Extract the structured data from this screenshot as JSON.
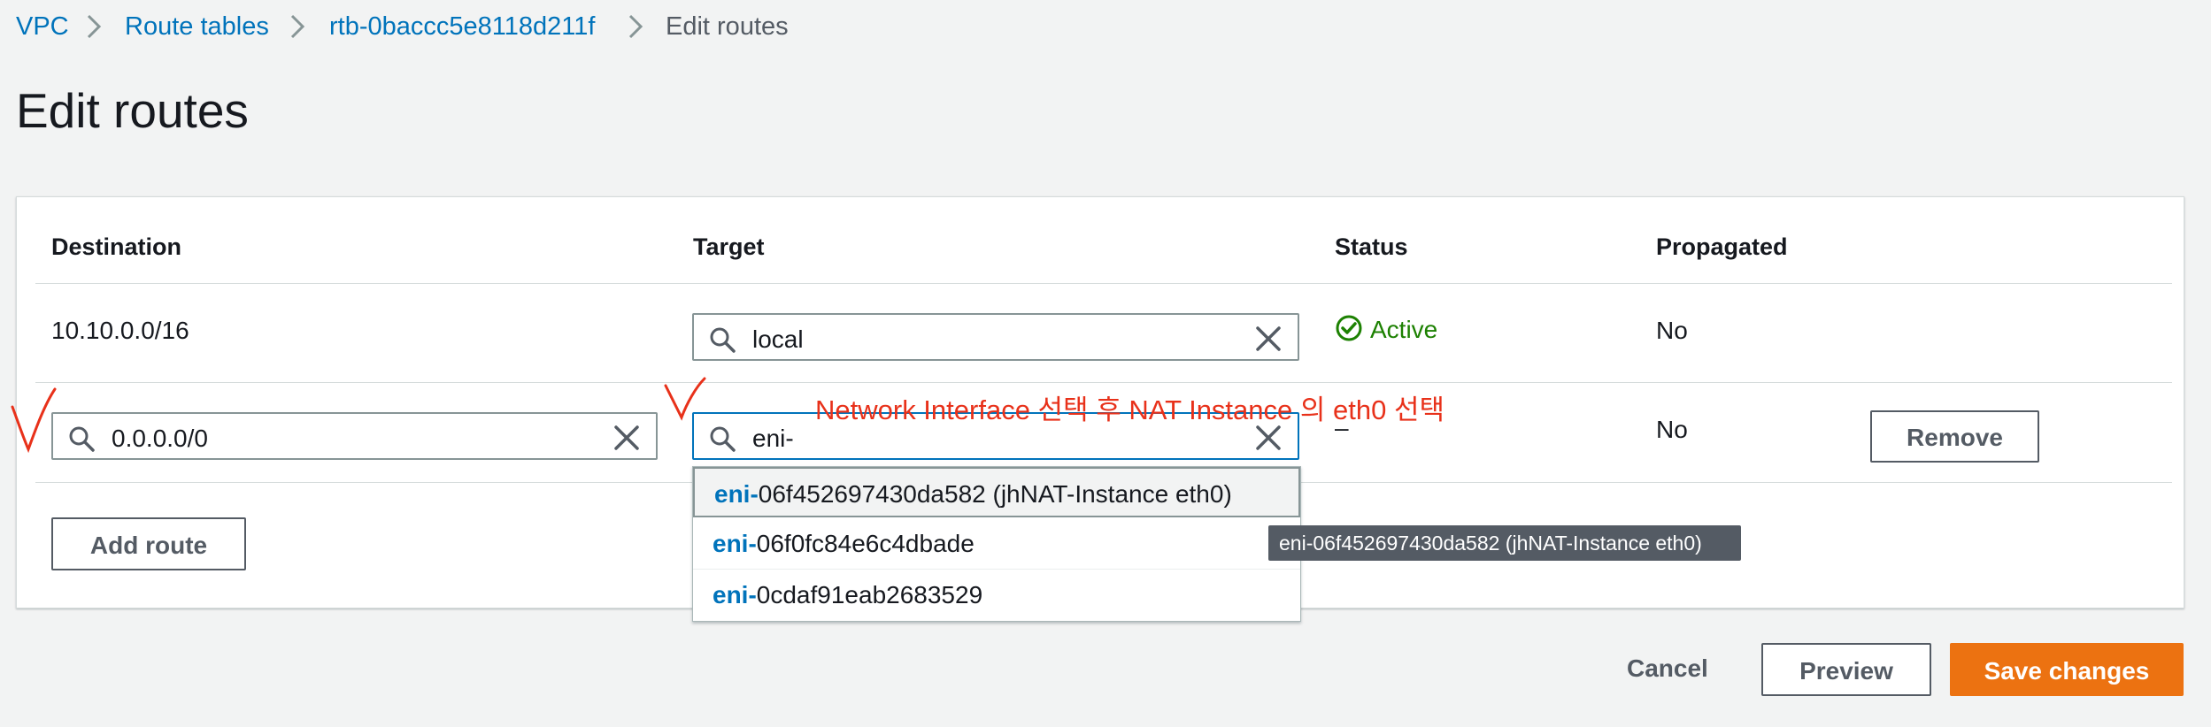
{
  "breadcrumb": {
    "items": [
      "VPC",
      "Route tables",
      "rtb-0baccc5e8118d211f"
    ],
    "current": "Edit routes"
  },
  "page": {
    "title": "Edit routes"
  },
  "table": {
    "headers": {
      "destination": "Destination",
      "target": "Target",
      "status": "Status",
      "propagated": "Propagated"
    },
    "rows": [
      {
        "destination": "10.10.0.0/16",
        "target": "local",
        "status": "Active",
        "propagated": "No"
      },
      {
        "destination": "0.0.0.0/0",
        "target": "eni-",
        "status": "–",
        "propagated": "No",
        "remove_label": "Remove"
      }
    ],
    "add_route_label": "Add route"
  },
  "dropdown": {
    "match_prefix": "eni-",
    "options": [
      {
        "suffix": "06f452697430da582 (jhNAT-Instance eth0)",
        "selected": true
      },
      {
        "suffix": "06f0fc84e6c4dbade",
        "selected": false
      },
      {
        "suffix": "0cdaf91eab2683529",
        "selected": false
      }
    ],
    "tooltip": "eni-06f452697430da582 (jhNAT-Instance eth0)"
  },
  "annotation": {
    "text": "Network Interface 선택 후 NAT Instance 의 eth0 선택",
    "color": "#e8311a"
  },
  "footer": {
    "cancel_label": "Cancel",
    "preview_label": "Preview",
    "save_label": "Save changes"
  },
  "colors": {
    "link": "#0073bb",
    "primary": "#ec7211",
    "success": "#1d8102",
    "annotation": "#e8311a"
  }
}
